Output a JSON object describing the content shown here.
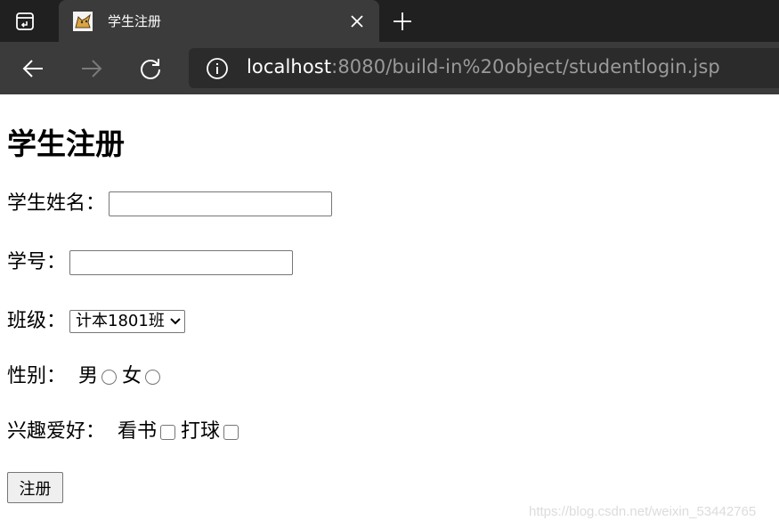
{
  "browser": {
    "tab_title": "学生注册",
    "url_host": "localhost",
    "url_rest": ":8080/build-in%20object/studentlogin.jsp",
    "icons": {
      "tab_actions": "tab-actions-icon",
      "favicon": "tomcat-icon",
      "close": "close-icon",
      "new_tab": "plus-icon",
      "back": "arrow-left-icon",
      "forward": "arrow-right-icon",
      "refresh": "refresh-icon",
      "info": "info-icon"
    }
  },
  "form": {
    "heading": "学生注册",
    "name_label": "学生姓名：",
    "name_value": "",
    "id_label": "学号：",
    "id_value": "",
    "class_label": "班级：",
    "class_selected": "计本1801班",
    "gender_label": "性别：",
    "gender_male": "男",
    "gender_female": "女",
    "hobby_label": "兴趣爱好：",
    "hobby_reading": "看书",
    "hobby_ball": "打球",
    "submit_label": "注册"
  },
  "watermark": "https://blog.csdn.net/weixin_53442765"
}
